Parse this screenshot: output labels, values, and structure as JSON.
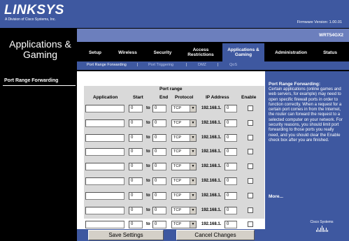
{
  "header": {
    "brand": "LINKSYS",
    "brand_sub": "A Division of Cisco Systems, Inc.",
    "firmware": "Firmware Version: 1.00.01",
    "model": "WRT54GX2"
  },
  "section_title": "Applications & Gaming",
  "tabs": [
    {
      "label": "Setup"
    },
    {
      "label": "Wireless"
    },
    {
      "label": "Security"
    },
    {
      "label": "Access Restrictions"
    },
    {
      "label": "Applications & Gaming"
    },
    {
      "label": "Administration"
    },
    {
      "label": "Status"
    }
  ],
  "subtabs": [
    {
      "label": "Port Range Forwarding"
    },
    {
      "label": "Port Triggering"
    },
    {
      "label": "DMZ"
    },
    {
      "label": "QoS"
    }
  ],
  "left_label": "Port Range Forwarding",
  "table": {
    "group_header": "Port range",
    "columns": [
      "Application",
      "Start",
      "End",
      "Protocol",
      "IP Address",
      "Enable"
    ],
    "to_label": "to",
    "rows": [
      {
        "application": "",
        "start": "0",
        "end": "0",
        "protocol": "TCP",
        "ip_prefix": "192.168.1.",
        "ip_last": "0",
        "enabled": false
      },
      {
        "application": "",
        "start": "0",
        "end": "0",
        "protocol": "TCP",
        "ip_prefix": "192.168.1.",
        "ip_last": "0",
        "enabled": false
      },
      {
        "application": "",
        "start": "0",
        "end": "0",
        "protocol": "TCP",
        "ip_prefix": "192.168.1.",
        "ip_last": "0",
        "enabled": false
      },
      {
        "application": "",
        "start": "0",
        "end": "0",
        "protocol": "TCP",
        "ip_prefix": "192.168.1.",
        "ip_last": "0",
        "enabled": false
      },
      {
        "application": "",
        "start": "0",
        "end": "0",
        "protocol": "TCP",
        "ip_prefix": "192.168.1.",
        "ip_last": "0",
        "enabled": false
      },
      {
        "application": "",
        "start": "0",
        "end": "0",
        "protocol": "TCP",
        "ip_prefix": "192.168.1.",
        "ip_last": "0",
        "enabled": false
      },
      {
        "application": "",
        "start": "0",
        "end": "0",
        "protocol": "TCP",
        "ip_prefix": "192.168.1.",
        "ip_last": "0",
        "enabled": false
      },
      {
        "application": "",
        "start": "0",
        "end": "0",
        "protocol": "TCP",
        "ip_prefix": "192.168.1.",
        "ip_last": "0",
        "enabled": false
      },
      {
        "application": "",
        "start": "0",
        "end": "0",
        "protocol": "TCP",
        "ip_prefix": "192.168.1.",
        "ip_last": "0",
        "enabled": false
      }
    ]
  },
  "buttons": {
    "save": "Save Settings",
    "cancel": "Cancel Changes"
  },
  "help": {
    "title": "Port Range Forwarding:",
    "body": "Certain applications (online games and web servers, for example) may need to open specific firewall ports in order to function correctly. When a request for a certain port comes in from the Internet, the router can forward the request to a selected computer on your network. For security reasons, you should limit port forwarding to those ports you really need, and you should clear the Enable check box after you are finished.",
    "more": "More..."
  },
  "footer_logo": "Cisco Systems",
  "colors": {
    "brand_blue": "#3e58a0",
    "black": "#000000",
    "grid_gray": "#d9d9d9"
  }
}
